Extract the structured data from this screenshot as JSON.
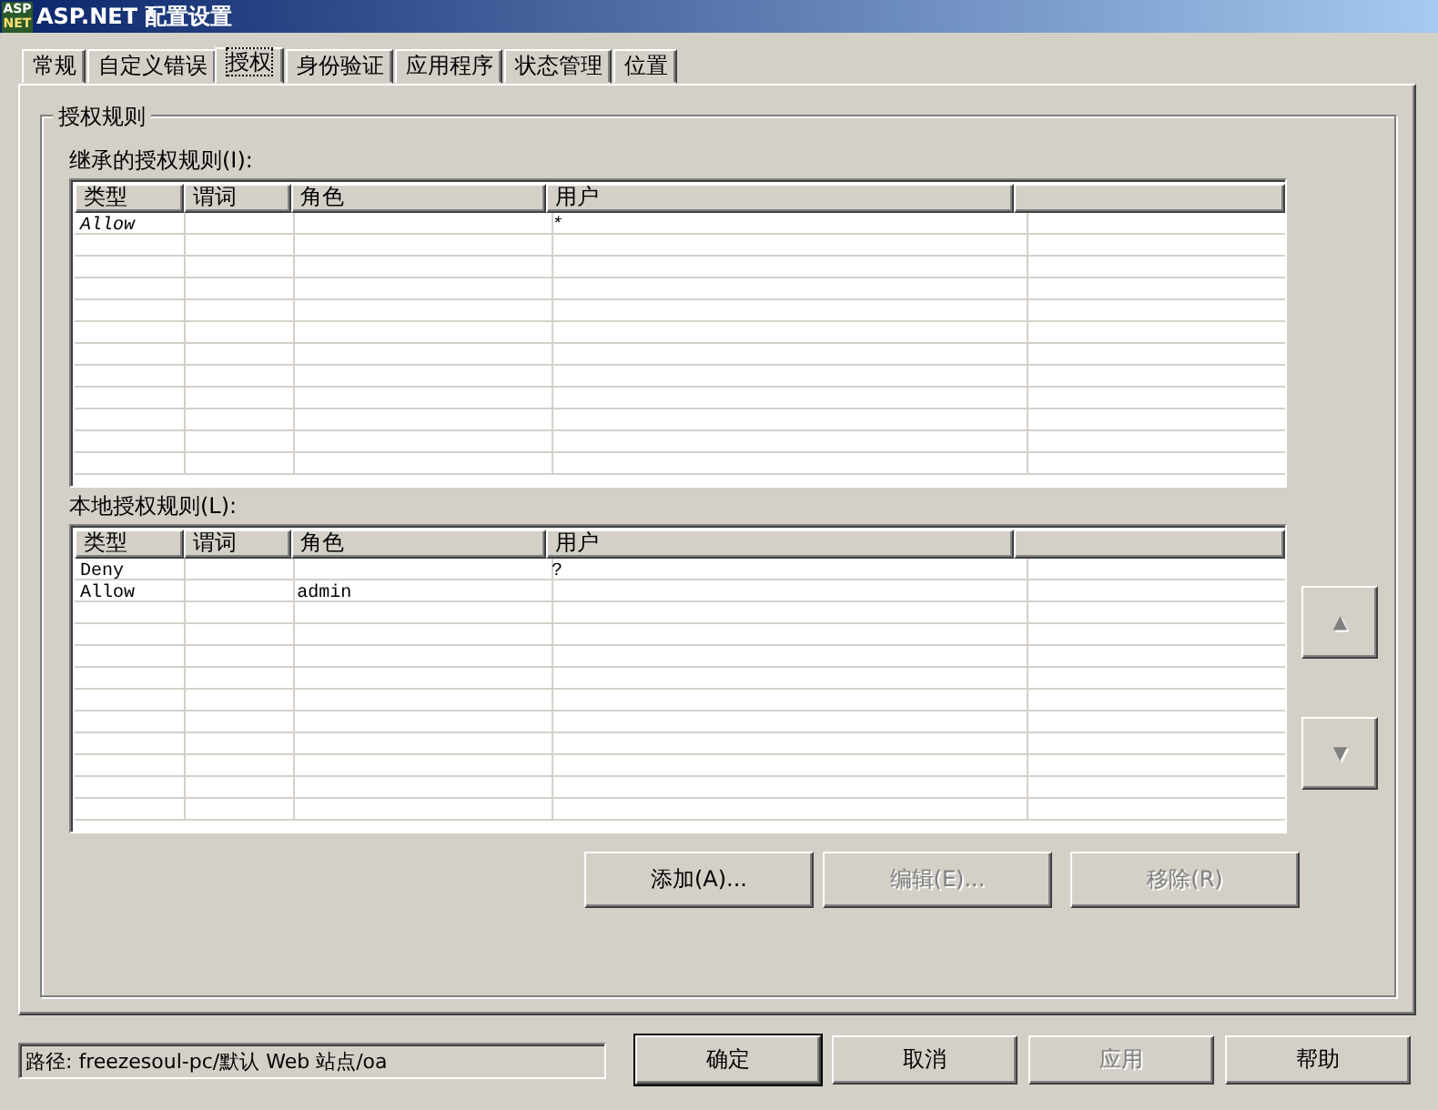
{
  "window": {
    "title": "ASP.NET 配置设置",
    "icon_label": [
      "ASP",
      "NET"
    ]
  },
  "tabs": [
    {
      "label": "常规",
      "selected": false
    },
    {
      "label": "自定义错误",
      "selected": false
    },
    {
      "label": "授权",
      "selected": true
    },
    {
      "label": "身份验证",
      "selected": false
    },
    {
      "label": "应用程序",
      "selected": false
    },
    {
      "label": "状态管理",
      "selected": false
    },
    {
      "label": "位置",
      "selected": false
    }
  ],
  "group": {
    "title": "授权规则"
  },
  "tables": [
    {
      "label": "继承的授权规则(I):",
      "columns": [
        "类型",
        "谓词",
        "角色",
        "用户"
      ],
      "rows": [
        {
          "cells": [
            "Allow",
            "",
            "",
            "*"
          ],
          "inherited": true
        }
      ]
    },
    {
      "label": "本地授权规则(L):",
      "columns": [
        "类型",
        "谓词",
        "角色",
        "用户"
      ],
      "rows": [
        {
          "cells": [
            "Deny",
            "",
            "",
            "?"
          ],
          "inherited": false
        },
        {
          "cells": [
            "Allow",
            "",
            "admin",
            ""
          ],
          "inherited": false
        }
      ]
    }
  ],
  "move_buttons": [
    {
      "glyph": "▲",
      "disabled": true
    },
    {
      "glyph": "▼",
      "disabled": true
    }
  ],
  "rule_buttons": [
    {
      "label": "添加(A)...",
      "disabled": false
    },
    {
      "label": "编辑(E)...",
      "disabled": true
    },
    {
      "label": "移除(R)",
      "disabled": true
    }
  ],
  "status_bar": {
    "path": "路径: freezesoul-pc/默认 Web 站点/oa"
  },
  "dialog_buttons": [
    {
      "label": "确定",
      "disabled": false,
      "default": true
    },
    {
      "label": "取消",
      "disabled": false,
      "default": false
    },
    {
      "label": "应用",
      "disabled": true,
      "default": false
    },
    {
      "label": "帮助",
      "disabled": false,
      "default": false
    }
  ]
}
